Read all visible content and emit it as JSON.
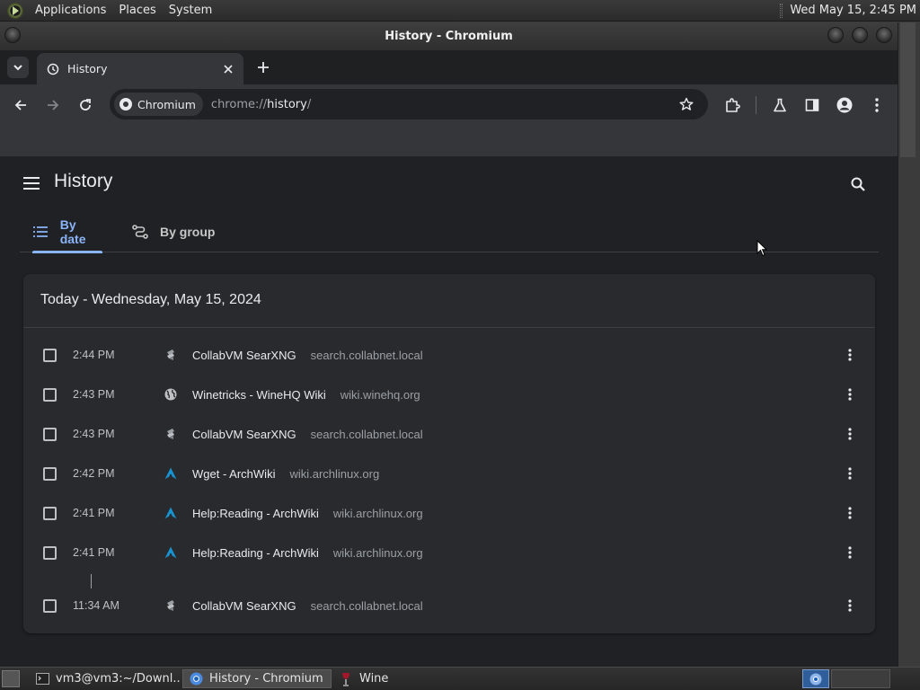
{
  "top_panel": {
    "menus": [
      "Applications",
      "Places",
      "System"
    ],
    "clock": "Wed May 15,  2:45 PM"
  },
  "window": {
    "title": "History - Chromium"
  },
  "browser": {
    "tab_title": "History",
    "site_chip": "Chromium",
    "url_scheme": "chrome://",
    "url_host": "history",
    "url_path": "/"
  },
  "history": {
    "page_title": "History",
    "tabs": [
      {
        "label": "By date",
        "selected": true
      },
      {
        "label": "By group",
        "selected": false
      }
    ],
    "section_title": "Today - Wednesday, May 15, 2024",
    "entries": [
      {
        "time": "2:44 PM",
        "favicon": "searxng-icon",
        "title": "CollabVM SearXNG",
        "domain": "search.collabnet.local"
      },
      {
        "time": "2:43 PM",
        "favicon": "globe-icon",
        "title": "Winetricks - WineHQ Wiki",
        "domain": "wiki.winehq.org"
      },
      {
        "time": "2:43 PM",
        "favicon": "searxng-icon",
        "title": "CollabVM SearXNG",
        "domain": "search.collabnet.local"
      },
      {
        "time": "2:42 PM",
        "favicon": "archlinux-icon",
        "title": "Wget - ArchWiki",
        "domain": "wiki.archlinux.org"
      },
      {
        "time": "2:41 PM",
        "favicon": "archlinux-icon",
        "title": "Help:Reading - ArchWiki",
        "domain": "wiki.archlinux.org"
      },
      {
        "time": "2:41 PM",
        "favicon": "archlinux-icon",
        "title": "Help:Reading - ArchWiki",
        "domain": "wiki.archlinux.org"
      },
      {
        "time": "11:34 AM",
        "favicon": "searxng-icon",
        "title": "CollabVM SearXNG",
        "domain": "search.collabnet.local"
      }
    ]
  },
  "taskbar": {
    "tasks": [
      {
        "label": "vm3@vm3:~/Downl...",
        "icon": "terminal-icon",
        "active": false
      },
      {
        "label": "History - Chromium",
        "icon": "chromium-icon",
        "active": true
      },
      {
        "label": "Wine",
        "icon": "wine-icon",
        "active": false
      }
    ]
  },
  "colors": {
    "accent": "#8ab4f8",
    "page_bg": "#202124",
    "card_bg": "#292a2d",
    "arch_blue": "#1793d1"
  }
}
